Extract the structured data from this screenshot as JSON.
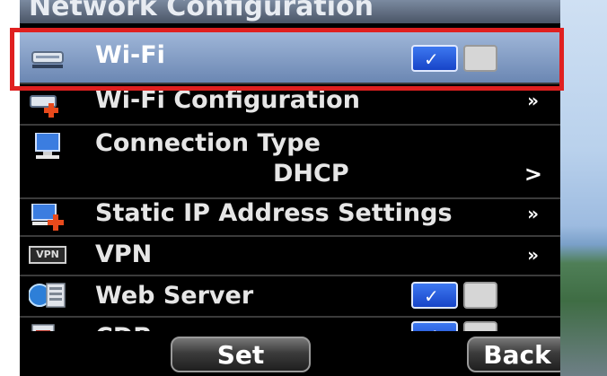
{
  "screen": {
    "title": "Network Configuration"
  },
  "menu": {
    "items": [
      {
        "label": "Wi-Fi",
        "icon": "wifi-router-icon",
        "control": "toggle",
        "toggle_on": true
      },
      {
        "label": "Wi-Fi Configuration",
        "icon": "wifi-config-icon",
        "control": "submenu",
        "arrow": "»"
      },
      {
        "label": "Connection Type",
        "value": "DHCP",
        "icon": "connection-type-icon",
        "control": "value",
        "arrow": ">"
      },
      {
        "label": "Static IP Address Settings",
        "icon": "static-ip-icon",
        "control": "submenu",
        "arrow": "»"
      },
      {
        "label": "VPN",
        "icon": "vpn-icon",
        "icon_text": "VPN",
        "control": "submenu",
        "arrow": "»"
      },
      {
        "label": "Web Server",
        "icon": "web-server-icon",
        "control": "toggle",
        "toggle_on": true
      },
      {
        "label": "CDP",
        "icon": "cdp-icon",
        "control": "toggle",
        "toggle_on": true
      }
    ]
  },
  "softkeys": {
    "set_label": "Set",
    "back_label": "Back"
  },
  "colors": {
    "highlight": "#e02020",
    "selected_row": "#8aa3c9",
    "toggle_on": "#2a5ee0"
  },
  "check_glyph": "✓"
}
